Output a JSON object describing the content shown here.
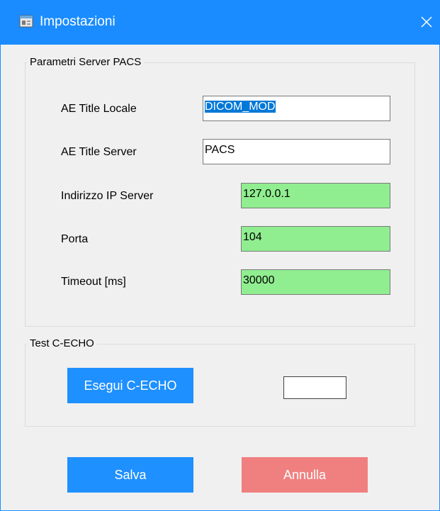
{
  "window": {
    "title": "Impostazioni",
    "icon": "settings-window-icon",
    "close_icon": "close-icon"
  },
  "pacs_group": {
    "legend": "Parametri Server PACS",
    "ae_title_local": {
      "label": "AE Title Locale",
      "value": "DICOM_MOD",
      "selected": true
    },
    "ae_title_server": {
      "label": "AE Title Server",
      "value": "PACS"
    },
    "ip_address": {
      "label": "Indirizzo IP Server",
      "value": "127.0.0.1"
    },
    "port": {
      "label": "Porta",
      "value": "104"
    },
    "timeout": {
      "label": "Timeout [ms]",
      "value": "30000"
    }
  },
  "echo_group": {
    "legend": "Test C-ECHO",
    "run_button": "Esegui C-ECHO",
    "result": ""
  },
  "footer": {
    "save_button": "Salva",
    "cancel_button": "Annulla"
  },
  "colors": {
    "titlebar": "#1a8cff",
    "button_blue": "#1e90ff",
    "button_red": "#f08080",
    "field_green": "#90ee90",
    "selection": "#0078d7"
  }
}
